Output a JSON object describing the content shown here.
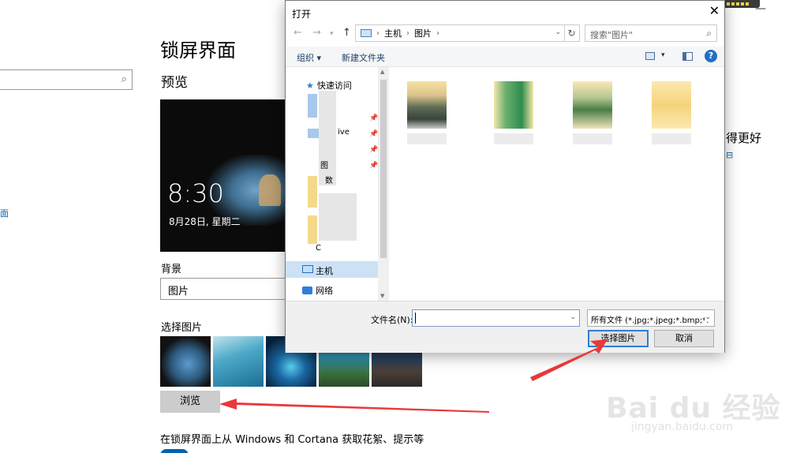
{
  "settings": {
    "page_title": "锁屏界面",
    "preview_label": "预览",
    "preview_time": "8:30",
    "preview_date": "8月28日, 星期二",
    "background_label": "背景",
    "background_value": "图片",
    "choose_picture_label": "选择图片",
    "browse_button": "浏览",
    "cortana_text": "在锁屏界面上从 Windows 和 Cortana 获取花絮、提示等",
    "left_link_text": "面",
    "right_text": "得更好",
    "right_dash": "—"
  },
  "dialog": {
    "title": "打开",
    "close_glyph": "✕",
    "breadcrumb": [
      "主机",
      "图片"
    ],
    "search_placeholder": "搜索\"图片\"",
    "organize": "组织 ▾",
    "new_folder": "新建文件夹",
    "nav": {
      "quick_access": "快速访问",
      "partial_items": [
        "ive",
        "图",
        "数",
        "C"
      ],
      "this_pc": "主机",
      "network": "网络"
    },
    "filename_label": "文件名(N):",
    "filename_value": "",
    "filetype_value": "所有文件 (*.jpg;*.jpeg;*.bmp;*.",
    "select_button": "选择图片",
    "cancel_button": "取消"
  },
  "watermark": {
    "main": "Bai du 经验",
    "sub": "jingyan.baidu.com"
  },
  "colors": {
    "accent": "#2c7fd6",
    "link": "#0063b1",
    "arrow": "#e8393b"
  }
}
